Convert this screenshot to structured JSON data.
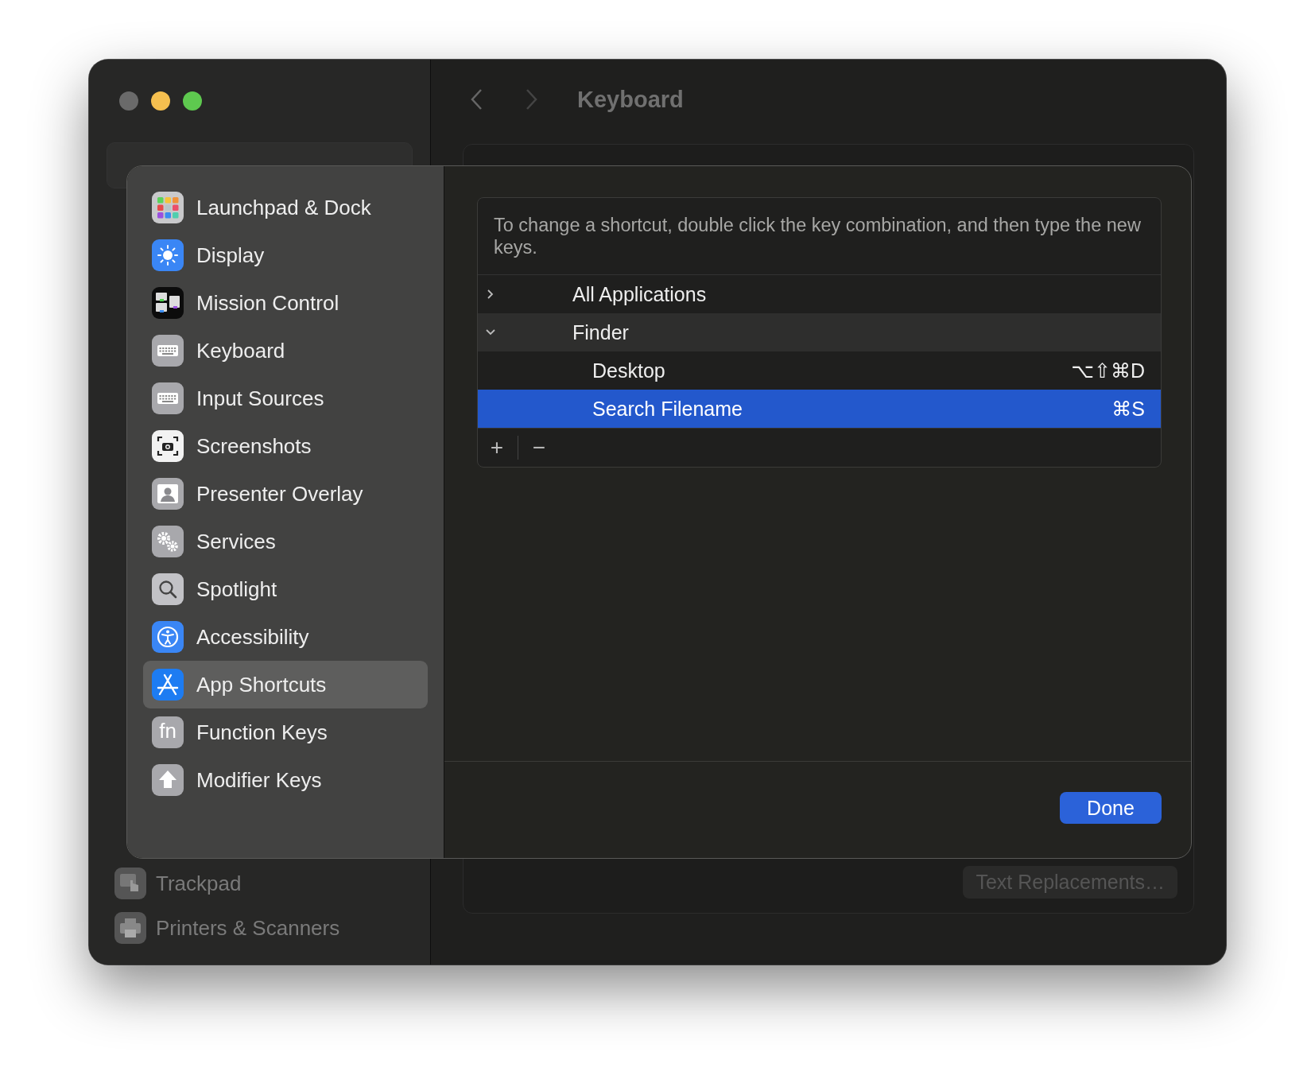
{
  "window": {
    "title": "Keyboard"
  },
  "background_sidebar": {
    "items": [
      {
        "label": "Trackpad",
        "kind": "trackpad"
      },
      {
        "label": "Printers & Scanners",
        "kind": "printer"
      }
    ]
  },
  "background_button": "Text Replacements…",
  "dialog": {
    "sidebar": {
      "items": [
        {
          "label": "Launchpad & Dock",
          "kind": "launchpad",
          "selected": false
        },
        {
          "label": "Display",
          "kind": "display",
          "selected": false
        },
        {
          "label": "Mission Control",
          "kind": "mission",
          "selected": false
        },
        {
          "label": "Keyboard",
          "kind": "keyboard",
          "selected": false
        },
        {
          "label": "Input Sources",
          "kind": "keyboard",
          "selected": false
        },
        {
          "label": "Screenshots",
          "kind": "screenshot",
          "selected": false
        },
        {
          "label": "Presenter Overlay",
          "kind": "person",
          "selected": false
        },
        {
          "label": "Services",
          "kind": "gears",
          "selected": false
        },
        {
          "label": "Spotlight",
          "kind": "search",
          "selected": false
        },
        {
          "label": "Accessibility",
          "kind": "accessibility",
          "selected": false
        },
        {
          "label": "App Shortcuts",
          "kind": "appstore",
          "selected": true
        },
        {
          "label": "Function Keys",
          "kind": "fn",
          "icon_text": "fn",
          "selected": false
        },
        {
          "label": "Modifier Keys",
          "kind": "modifier",
          "selected": false
        }
      ]
    },
    "info": "To change a shortcut, double click the key combination, and then type the new keys.",
    "shortcuts": [
      {
        "label": "All Applications",
        "expanded": false
      },
      {
        "label": "Finder",
        "expanded": true,
        "children": [
          {
            "label": "Desktop",
            "shortcut": "⌥⇧⌘D",
            "selected": false
          },
          {
            "label": "Search Filename",
            "shortcut": "⌘S",
            "selected": true
          }
        ]
      }
    ],
    "add_button": "+",
    "remove_button": "−",
    "done_button": "Done"
  }
}
